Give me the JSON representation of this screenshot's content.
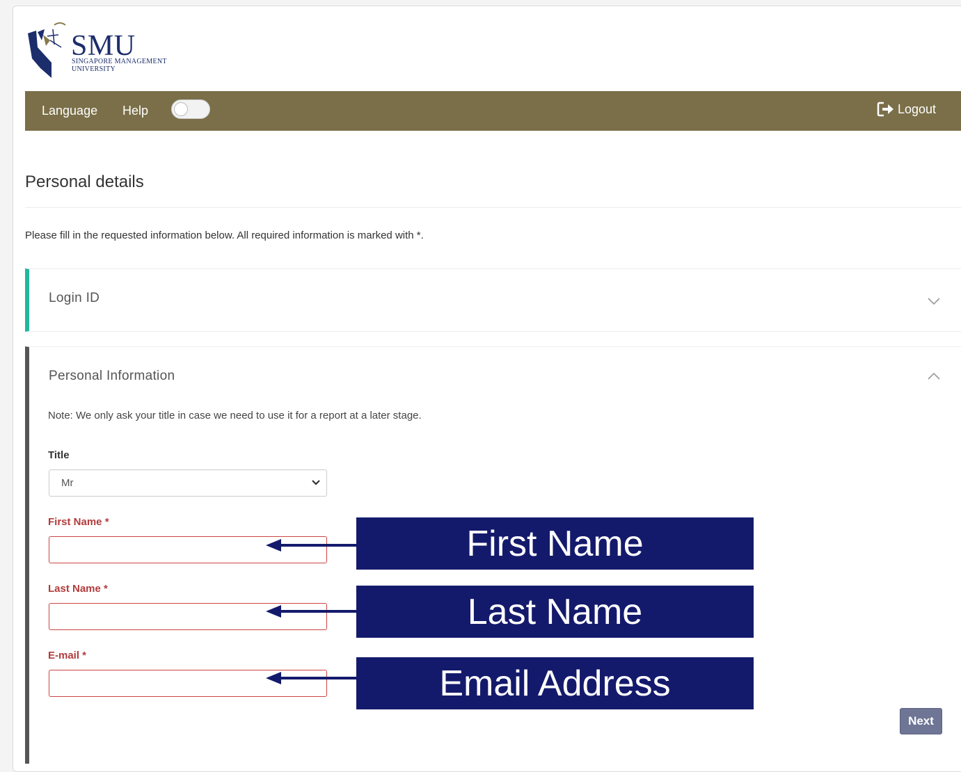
{
  "brand": {
    "name": "SMU",
    "subtitle_line1": "SINGAPORE MANAGEMENT",
    "subtitle_line2": "UNIVERSITY",
    "colors": {
      "navy": "#1c2d6b",
      "navbar": "#7a6f48",
      "accent_teal": "#22b79e",
      "required_red": "#b23c3c",
      "callout_bg": "#141a6b"
    }
  },
  "navbar": {
    "language_label": "Language",
    "help_label": "Help",
    "toggle_state": "off",
    "logout_label": "Logout",
    "logout_icon": "sign-out-icon"
  },
  "page": {
    "title": "Personal details",
    "intro": "Please fill in the requested information below. All required information is marked with *."
  },
  "panels": {
    "login": {
      "title": "Login ID",
      "state": "collapsed",
      "icon": "chevron-down-icon"
    },
    "personal": {
      "title": "Personal Information",
      "state": "expanded",
      "icon": "chevron-up-icon",
      "note": "Note: We only ask your title in case we need to use it for a report at a later stage."
    }
  },
  "form": {
    "title_label": "Title",
    "title_value": "Mr",
    "first_name_label": "First Name *",
    "first_name_value": "",
    "last_name_label": "Last Name *",
    "last_name_value": "",
    "email_label": "E-mail *",
    "email_value": ""
  },
  "annotations": {
    "first_name": "First Name",
    "last_name": "Last Name",
    "email": "Email Address"
  },
  "actions": {
    "next_label": "Next"
  }
}
